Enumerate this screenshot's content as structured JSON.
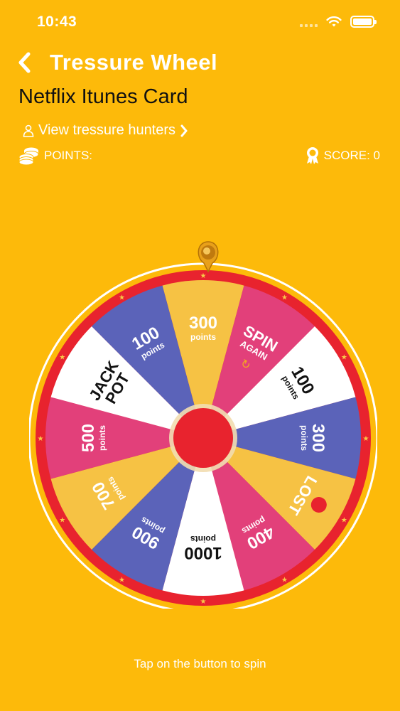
{
  "status_bar": {
    "time": "10:43"
  },
  "nav": {
    "back_icon": "chevron-left-icon",
    "title": "Tressure Wheel"
  },
  "prize": {
    "title": "Netflix Itunes Card"
  },
  "hunters_link": {
    "label": "View tressure hunters",
    "icon": "person-icon",
    "chevron": "chevron-right-icon"
  },
  "stats": {
    "points_label": "POINTS:",
    "points_icon": "coins-icon",
    "score_label": "SCORE: 0",
    "score_icon": "award-ribbon-icon"
  },
  "wheel": {
    "rim_color": "#E8232E",
    "segments": [
      {
        "line1": "300",
        "line2": "points",
        "color": "#F6C244",
        "text_color": "#ffffff",
        "dark": false
      },
      {
        "line1": "SPIN",
        "line2": "AGAIN",
        "color": "#E2407A",
        "text_color": "#ffffff",
        "dark": false
      },
      {
        "line1": "100",
        "line2": "points",
        "color": "#ffffff",
        "text_color": "#111111",
        "dark": true
      },
      {
        "line1": "300",
        "line2": "points",
        "color": "#5B63B9",
        "text_color": "#ffffff",
        "dark": false
      },
      {
        "line1": "LOST",
        "line2": "",
        "color": "#F6C244",
        "text_color": "#ffffff",
        "dark": false
      },
      {
        "line1": "400",
        "line2": "points",
        "color": "#E2407A",
        "text_color": "#ffffff",
        "dark": false
      },
      {
        "line1": "1000",
        "line2": "points",
        "color": "#ffffff",
        "text_color": "#111111",
        "dark": true
      },
      {
        "line1": "900",
        "line2": "points",
        "color": "#5B63B9",
        "text_color": "#ffffff",
        "dark": false
      },
      {
        "line1": "700",
        "line2": "points",
        "color": "#F6C244",
        "text_color": "#ffffff",
        "dark": false
      },
      {
        "line1": "500",
        "line2": "points",
        "color": "#E2407A",
        "text_color": "#ffffff",
        "dark": false
      },
      {
        "line1": "JACK",
        "line2": "POT",
        "color": "#ffffff",
        "text_color": "#111111",
        "dark": true
      },
      {
        "line1": "100",
        "line2": "points",
        "color": "#5B63B9",
        "text_color": "#ffffff",
        "dark": false
      }
    ]
  },
  "hint": "Tap on the button to spin"
}
